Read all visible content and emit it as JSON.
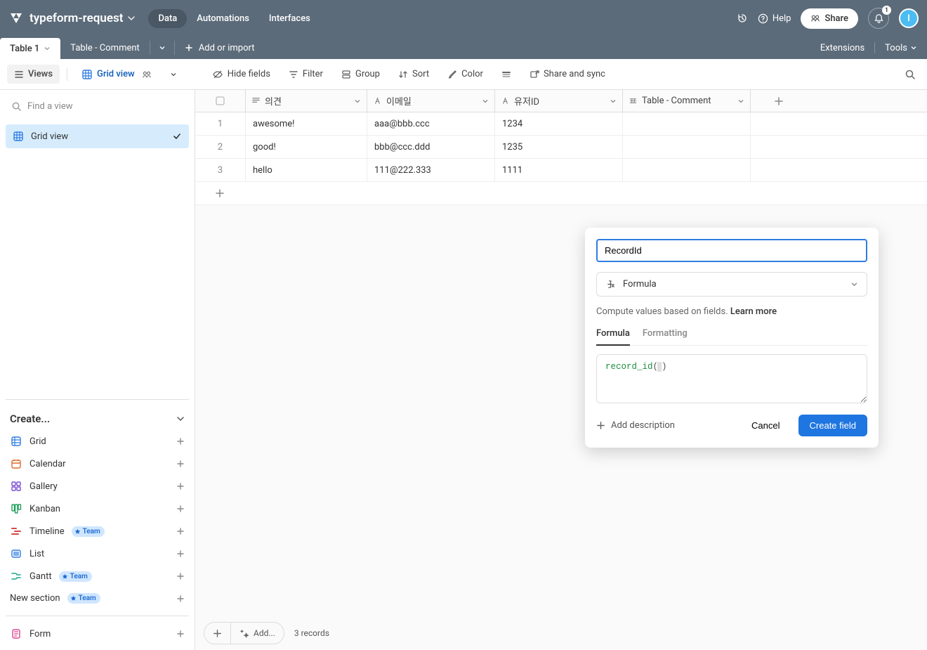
{
  "header": {
    "workspace": "typeform-request",
    "tabs": [
      "Data",
      "Automations",
      "Interfaces"
    ],
    "active_tab": 0,
    "help_label": "Help",
    "share_label": "Share",
    "notification_count": "1",
    "avatar_letter": "I"
  },
  "tabbar": {
    "sheets": [
      {
        "name": "Table 1",
        "active": true
      },
      {
        "name": "Table - Comment",
        "active": false
      }
    ],
    "add_or_import": "Add or import",
    "extensions": "Extensions",
    "tools": "Tools"
  },
  "toolbar": {
    "views": "Views",
    "grid_view": "Grid view",
    "hide_fields": "Hide fields",
    "filter": "Filter",
    "group": "Group",
    "sort": "Sort",
    "color": "Color",
    "share_sync": "Share and sync"
  },
  "sidebar": {
    "find_placeholder": "Find a view",
    "views": [
      {
        "name": "Grid view",
        "active": true
      }
    ],
    "create_label": "Create...",
    "create_options": [
      {
        "name": "Grid",
        "color": "#2f7de1"
      },
      {
        "name": "Calendar",
        "color": "#e06a2b"
      },
      {
        "name": "Gallery",
        "color": "#7b4ed0"
      },
      {
        "name": "Kanban",
        "color": "#1e9e5a"
      },
      {
        "name": "Timeline",
        "color": "#d64848",
        "team": true
      },
      {
        "name": "List",
        "color": "#2f7de1"
      },
      {
        "name": "Gantt",
        "color": "#1aa890",
        "team": true
      },
      {
        "name": "New section",
        "color": "#333",
        "team": true
      }
    ],
    "form_label": "Form",
    "team_badge": "Team"
  },
  "grid": {
    "columns": [
      {
        "label": "의견",
        "type": "text"
      },
      {
        "label": "이메일",
        "type": "text"
      },
      {
        "label": "유저ID",
        "type": "text"
      },
      {
        "label": "Table - Comment",
        "type": "link"
      }
    ],
    "rows": [
      {
        "n": "1",
        "c": [
          "awesome!",
          "aaa@bbb.ccc",
          "1234",
          ""
        ]
      },
      {
        "n": "2",
        "c": [
          "good!",
          "bbb@ccc.ddd",
          "1235",
          ""
        ]
      },
      {
        "n": "3",
        "c": [
          "hello",
          "111@222.333",
          "1111",
          ""
        ]
      }
    ],
    "footer_add": "Add...",
    "record_count": "3 records"
  },
  "popup": {
    "field_name_value": "RecordId",
    "field_type": "Formula",
    "description": "Compute values based on fields.",
    "learn_more": "Learn more",
    "tabs": [
      "Formula",
      "Formatting"
    ],
    "active_tab": 0,
    "formula_fn": "record_id",
    "add_description": "Add description",
    "cancel": "Cancel",
    "create": "Create field"
  }
}
